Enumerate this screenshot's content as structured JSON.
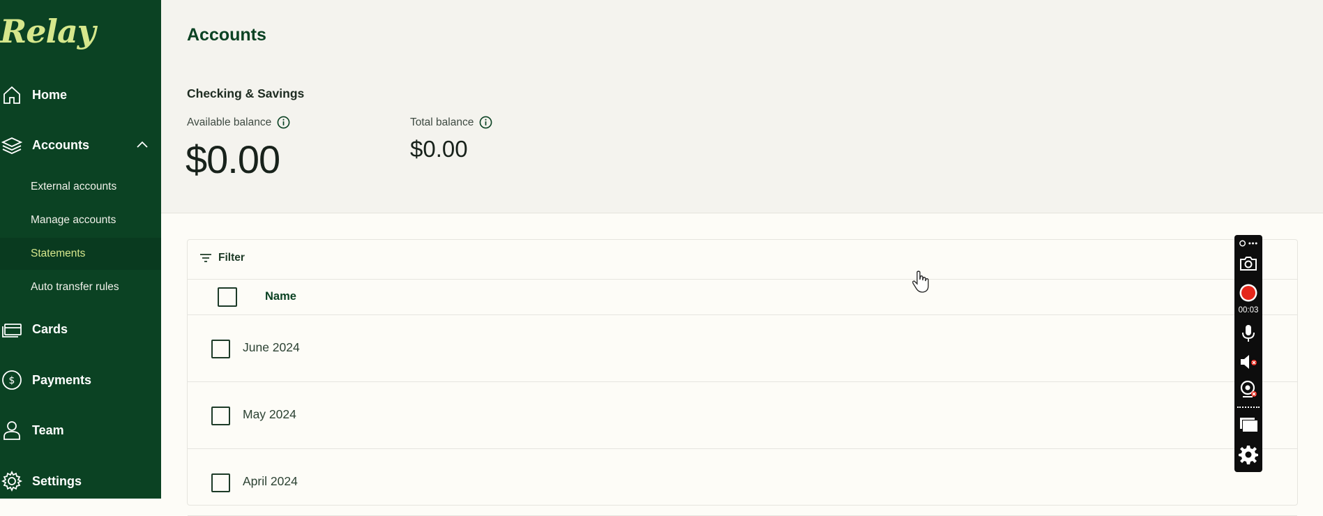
{
  "app": {
    "logo_text": "Relay"
  },
  "sidebar": {
    "items": [
      {
        "label": "Home",
        "icon": "home-icon"
      },
      {
        "label": "Accounts",
        "icon": "layers-icon",
        "expanded": true
      },
      {
        "label": "Cards",
        "icon": "card-icon"
      },
      {
        "label": "Payments",
        "icon": "dollar-circle-icon"
      },
      {
        "label": "Team",
        "icon": "person-icon"
      },
      {
        "label": "Settings",
        "icon": "gear-icon"
      }
    ],
    "sub_items": [
      {
        "label": "External accounts"
      },
      {
        "label": "Manage accounts"
      },
      {
        "label": "Statements",
        "active": true
      },
      {
        "label": "Auto transfer rules"
      }
    ]
  },
  "header": {
    "title": "Accounts",
    "section_title": "Checking & Savings",
    "available_label": "Available balance",
    "available_value": "$0.00",
    "total_label": "Total balance",
    "total_value": "$0.00"
  },
  "table": {
    "filter_label": "Filter",
    "column_name": "Name",
    "rows": [
      {
        "name": "June 2024"
      },
      {
        "name": "May 2024"
      },
      {
        "name": "April 2024"
      }
    ]
  },
  "recorder": {
    "time": "00:03",
    "icons": [
      "pin-more-icon",
      "camera-icon",
      "record-icon",
      "microphone-icon",
      "speaker-muted-icon",
      "webcam-off-icon",
      "screens-icon",
      "gear-icon"
    ]
  },
  "colors": {
    "sidebar_bg": "#0b4223",
    "accent_text": "#d6e78c",
    "record_red": "#e5271b"
  }
}
